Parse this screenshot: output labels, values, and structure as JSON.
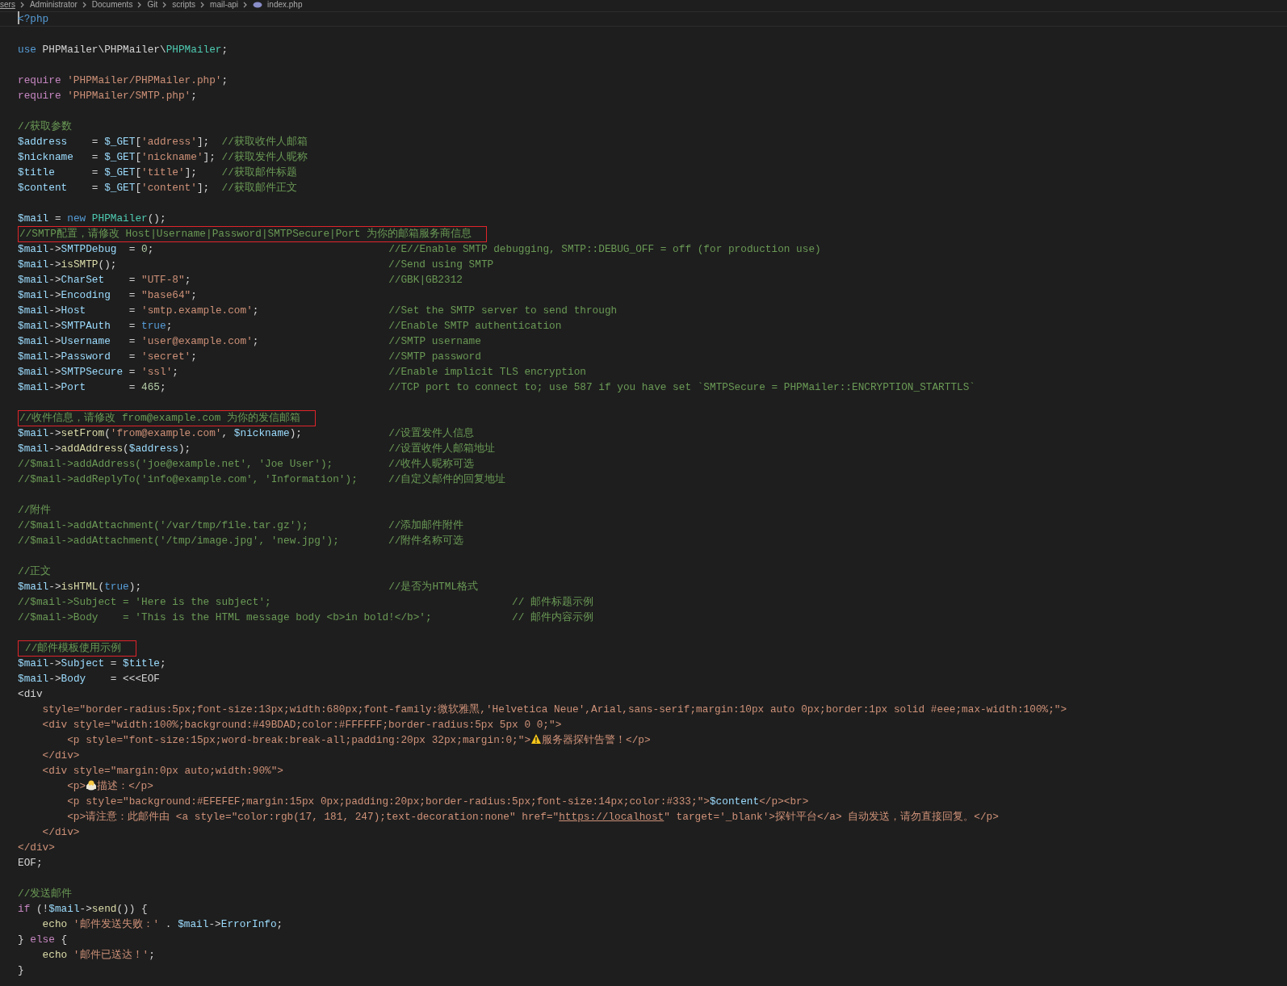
{
  "breadcrumb": [
    "sers",
    "Administrator",
    "Documents",
    "Git",
    "scripts",
    "mail-api",
    "index.php"
  ],
  "lines": [
    {
      "kind": "code",
      "current": true,
      "boxed": false,
      "tokens": [
        {
          "kind": "keyword",
          "text": "<?php"
        }
      ]
    },
    {
      "kind": "blank"
    },
    {
      "kind": "code",
      "current": false,
      "boxed": false,
      "tokens": [
        {
          "kind": "keyword",
          "text": "use"
        },
        {
          "kind": "plain",
          "text": " PHPMailer\\PHPMailer\\"
        },
        {
          "kind": "class",
          "text": "PHPMailer"
        },
        {
          "kind": "plain",
          "text": ";"
        }
      ]
    },
    {
      "kind": "blank"
    },
    {
      "kind": "code",
      "current": false,
      "boxed": false,
      "tokens": [
        {
          "kind": "control",
          "text": "require"
        },
        {
          "kind": "string",
          "text": " 'PHPMailer/PHPMailer.php'"
        },
        {
          "kind": "plain",
          "text": ";"
        }
      ]
    },
    {
      "kind": "code",
      "current": false,
      "boxed": false,
      "tokens": [
        {
          "kind": "control",
          "text": "require"
        },
        {
          "kind": "string",
          "text": " 'PHPMailer/SMTP.php'"
        },
        {
          "kind": "plain",
          "text": ";"
        }
      ]
    },
    {
      "kind": "blank"
    },
    {
      "kind": "code",
      "current": false,
      "boxed": false,
      "tokens": [
        {
          "kind": "comment",
          "text": "//获取参数"
        }
      ]
    },
    {
      "kind": "code",
      "current": false,
      "boxed": false,
      "tokens": [
        {
          "kind": "variable",
          "text": "$address"
        },
        {
          "kind": "plain",
          "text": "    = "
        },
        {
          "kind": "variable",
          "text": "$_GET"
        },
        {
          "kind": "plain",
          "text": "["
        },
        {
          "kind": "string",
          "text": "'address'"
        },
        {
          "kind": "plain",
          "text": "];  "
        },
        {
          "kind": "comment",
          "text": "//获取收件人邮箱"
        }
      ]
    },
    {
      "kind": "code",
      "current": false,
      "boxed": false,
      "tokens": [
        {
          "kind": "variable",
          "text": "$nickname"
        },
        {
          "kind": "plain",
          "text": "   = "
        },
        {
          "kind": "variable",
          "text": "$_GET"
        },
        {
          "kind": "plain",
          "text": "["
        },
        {
          "kind": "string",
          "text": "'nickname'"
        },
        {
          "kind": "plain",
          "text": "]; "
        },
        {
          "kind": "comment",
          "text": "//获取发件人昵称"
        }
      ]
    },
    {
      "kind": "code",
      "current": false,
      "boxed": false,
      "tokens": [
        {
          "kind": "variable",
          "text": "$title"
        },
        {
          "kind": "plain",
          "text": "      = "
        },
        {
          "kind": "variable",
          "text": "$_GET"
        },
        {
          "kind": "plain",
          "text": "["
        },
        {
          "kind": "string",
          "text": "'title'"
        },
        {
          "kind": "plain",
          "text": "];    "
        },
        {
          "kind": "comment",
          "text": "//获取邮件标题"
        }
      ]
    },
    {
      "kind": "code",
      "current": false,
      "boxed": false,
      "tokens": [
        {
          "kind": "variable",
          "text": "$content"
        },
        {
          "kind": "plain",
          "text": "    = "
        },
        {
          "kind": "variable",
          "text": "$_GET"
        },
        {
          "kind": "plain",
          "text": "["
        },
        {
          "kind": "string",
          "text": "'content'"
        },
        {
          "kind": "plain",
          "text": "];  "
        },
        {
          "kind": "comment",
          "text": "//获取邮件正文"
        }
      ]
    },
    {
      "kind": "blank"
    },
    {
      "kind": "code",
      "current": false,
      "boxed": false,
      "tokens": [
        {
          "kind": "variable",
          "text": "$mail"
        },
        {
          "kind": "plain",
          "text": " = "
        },
        {
          "kind": "keyword",
          "text": "new"
        },
        {
          "kind": "class",
          "text": " PHPMailer"
        },
        {
          "kind": "plain",
          "text": "();"
        }
      ]
    },
    {
      "kind": "code",
      "current": false,
      "boxed": true,
      "tokens": [
        {
          "kind": "comment",
          "text": "//SMTP配置，请修改 Host|Username|Password|SMTPSecure|Port 为你的邮箱服务商信息"
        }
      ]
    },
    {
      "kind": "code",
      "current": false,
      "boxed": false,
      "tokens": [
        {
          "kind": "variable",
          "text": "$mail"
        },
        {
          "kind": "plain",
          "text": "->"
        },
        {
          "kind": "variable",
          "text": "SMTPDebug"
        },
        {
          "kind": "plain",
          "text": "  = "
        },
        {
          "kind": "number",
          "text": "0"
        },
        {
          "kind": "plain",
          "text": ";                                      "
        },
        {
          "kind": "comment",
          "text": "//E//Enable SMTP debugging, SMTP::DEBUG_OFF = off (for production use)"
        }
      ]
    },
    {
      "kind": "code",
      "current": false,
      "boxed": false,
      "tokens": [
        {
          "kind": "variable",
          "text": "$mail"
        },
        {
          "kind": "plain",
          "text": "->"
        },
        {
          "kind": "function",
          "text": "isSMTP"
        },
        {
          "kind": "plain",
          "text": "();                                            "
        },
        {
          "kind": "comment",
          "text": "//Send using SMTP"
        }
      ]
    },
    {
      "kind": "code",
      "current": false,
      "boxed": false,
      "tokens": [
        {
          "kind": "variable",
          "text": "$mail"
        },
        {
          "kind": "plain",
          "text": "->"
        },
        {
          "kind": "variable",
          "text": "CharSet"
        },
        {
          "kind": "plain",
          "text": "    = "
        },
        {
          "kind": "string",
          "text": "\"UTF-8\""
        },
        {
          "kind": "plain",
          "text": ";                                "
        },
        {
          "kind": "comment",
          "text": "//GBK|GB2312"
        }
      ]
    },
    {
      "kind": "code",
      "current": false,
      "boxed": false,
      "tokens": [
        {
          "kind": "variable",
          "text": "$mail"
        },
        {
          "kind": "plain",
          "text": "->"
        },
        {
          "kind": "variable",
          "text": "Encoding"
        },
        {
          "kind": "plain",
          "text": "   = "
        },
        {
          "kind": "string",
          "text": "\"base64\""
        },
        {
          "kind": "plain",
          "text": ";"
        }
      ]
    },
    {
      "kind": "code",
      "current": false,
      "boxed": false,
      "tokens": [
        {
          "kind": "variable",
          "text": "$mail"
        },
        {
          "kind": "plain",
          "text": "->"
        },
        {
          "kind": "variable",
          "text": "Host"
        },
        {
          "kind": "plain",
          "text": "       = "
        },
        {
          "kind": "string",
          "text": "'smtp.example.com'"
        },
        {
          "kind": "plain",
          "text": ";                     "
        },
        {
          "kind": "comment",
          "text": "//Set the SMTP server to send through"
        }
      ]
    },
    {
      "kind": "code",
      "current": false,
      "boxed": false,
      "tokens": [
        {
          "kind": "variable",
          "text": "$mail"
        },
        {
          "kind": "plain",
          "text": "->"
        },
        {
          "kind": "variable",
          "text": "SMTPAuth"
        },
        {
          "kind": "plain",
          "text": "   = "
        },
        {
          "kind": "keyword",
          "text": "true"
        },
        {
          "kind": "plain",
          "text": ";                                   "
        },
        {
          "kind": "comment",
          "text": "//Enable SMTP authentication"
        }
      ]
    },
    {
      "kind": "code",
      "current": false,
      "boxed": false,
      "tokens": [
        {
          "kind": "variable",
          "text": "$mail"
        },
        {
          "kind": "plain",
          "text": "->"
        },
        {
          "kind": "variable",
          "text": "Username"
        },
        {
          "kind": "plain",
          "text": "   = "
        },
        {
          "kind": "string",
          "text": "'user@example.com'"
        },
        {
          "kind": "plain",
          "text": ";                     "
        },
        {
          "kind": "comment",
          "text": "//SMTP username"
        }
      ]
    },
    {
      "kind": "code",
      "current": false,
      "boxed": false,
      "tokens": [
        {
          "kind": "variable",
          "text": "$mail"
        },
        {
          "kind": "plain",
          "text": "->"
        },
        {
          "kind": "variable",
          "text": "Password"
        },
        {
          "kind": "plain",
          "text": "   = "
        },
        {
          "kind": "string",
          "text": "'secret'"
        },
        {
          "kind": "plain",
          "text": ";                               "
        },
        {
          "kind": "comment",
          "text": "//SMTP password"
        }
      ]
    },
    {
      "kind": "code",
      "current": false,
      "boxed": false,
      "tokens": [
        {
          "kind": "variable",
          "text": "$mail"
        },
        {
          "kind": "plain",
          "text": "->"
        },
        {
          "kind": "variable",
          "text": "SMTPSecure"
        },
        {
          "kind": "plain",
          "text": " = "
        },
        {
          "kind": "string",
          "text": "'ssl'"
        },
        {
          "kind": "plain",
          "text": ";                                  "
        },
        {
          "kind": "comment",
          "text": "//Enable implicit TLS encryption"
        }
      ]
    },
    {
      "kind": "code",
      "current": false,
      "boxed": false,
      "tokens": [
        {
          "kind": "variable",
          "text": "$mail"
        },
        {
          "kind": "plain",
          "text": "->"
        },
        {
          "kind": "variable",
          "text": "Port"
        },
        {
          "kind": "plain",
          "text": "       = "
        },
        {
          "kind": "number",
          "text": "465"
        },
        {
          "kind": "plain",
          "text": ";                                    "
        },
        {
          "kind": "comment",
          "text": "//TCP port to connect to; use 587 if you have set `SMTPSecure = PHPMailer::ENCRYPTION_STARTTLS`"
        }
      ]
    },
    {
      "kind": "blank"
    },
    {
      "kind": "code",
      "current": false,
      "boxed": true,
      "tokens": [
        {
          "kind": "comment",
          "text": "//收件信息，请修改 from@example.com 为你的发信邮箱"
        }
      ]
    },
    {
      "kind": "code",
      "current": false,
      "boxed": false,
      "tokens": [
        {
          "kind": "variable",
          "text": "$mail"
        },
        {
          "kind": "plain",
          "text": "->"
        },
        {
          "kind": "function",
          "text": "setFrom"
        },
        {
          "kind": "plain",
          "text": "("
        },
        {
          "kind": "string",
          "text": "'from@example.com'"
        },
        {
          "kind": "plain",
          "text": ", "
        },
        {
          "kind": "variable",
          "text": "$nickname"
        },
        {
          "kind": "plain",
          "text": ");              "
        },
        {
          "kind": "comment",
          "text": "//设置发件人信息"
        }
      ]
    },
    {
      "kind": "code",
      "current": false,
      "boxed": false,
      "tokens": [
        {
          "kind": "variable",
          "text": "$mail"
        },
        {
          "kind": "plain",
          "text": "->"
        },
        {
          "kind": "function",
          "text": "addAddress"
        },
        {
          "kind": "plain",
          "text": "("
        },
        {
          "kind": "variable",
          "text": "$address"
        },
        {
          "kind": "plain",
          "text": ");                                "
        },
        {
          "kind": "comment",
          "text": "//设置收件人邮箱地址"
        }
      ]
    },
    {
      "kind": "code",
      "current": false,
      "boxed": false,
      "tokens": [
        {
          "kind": "comment",
          "text": "//$mail->addAddress('joe@example.net', 'Joe User');         //收件人昵称可选"
        }
      ]
    },
    {
      "kind": "code",
      "current": false,
      "boxed": false,
      "tokens": [
        {
          "kind": "comment",
          "text": "//$mail->addReplyTo('info@example.com', 'Information');     //自定义邮件的回复地址"
        }
      ]
    },
    {
      "kind": "blank"
    },
    {
      "kind": "code",
      "current": false,
      "boxed": false,
      "tokens": [
        {
          "kind": "comment",
          "text": "//附件"
        }
      ]
    },
    {
      "kind": "code",
      "current": false,
      "boxed": false,
      "tokens": [
        {
          "kind": "comment",
          "text": "//$mail->addAttachment('/var/tmp/file.tar.gz');             //添加邮件附件"
        }
      ]
    },
    {
      "kind": "code",
      "current": false,
      "boxed": false,
      "tokens": [
        {
          "kind": "comment",
          "text": "//$mail->addAttachment('/tmp/image.jpg', 'new.jpg');        //附件名称可选"
        }
      ]
    },
    {
      "kind": "blank"
    },
    {
      "kind": "code",
      "current": false,
      "boxed": false,
      "tokens": [
        {
          "kind": "comment",
          "text": "//正文"
        }
      ]
    },
    {
      "kind": "code",
      "current": false,
      "boxed": false,
      "tokens": [
        {
          "kind": "variable",
          "text": "$mail"
        },
        {
          "kind": "plain",
          "text": "->"
        },
        {
          "kind": "function",
          "text": "isHTML"
        },
        {
          "kind": "plain",
          "text": "("
        },
        {
          "kind": "keyword",
          "text": "true"
        },
        {
          "kind": "plain",
          "text": ");                                        "
        },
        {
          "kind": "comment",
          "text": "//是否为HTML格式"
        }
      ]
    },
    {
      "kind": "code",
      "current": false,
      "boxed": false,
      "tokens": [
        {
          "kind": "comment",
          "text": "//$mail->Subject = 'Here is the subject';                                       // 邮件标题示例"
        }
      ]
    },
    {
      "kind": "code",
      "current": false,
      "boxed": false,
      "tokens": [
        {
          "kind": "comment",
          "text": "//$mail->Body    = 'This is the HTML message body <b>in bold!</b>';             // 邮件内容示例"
        }
      ]
    },
    {
      "kind": "blank"
    },
    {
      "kind": "code",
      "current": false,
      "boxed": true,
      "tokens": [
        {
          "kind": "comment",
          "text": "//邮件模板使用示例"
        }
      ]
    },
    {
      "kind": "code",
      "current": false,
      "boxed": false,
      "tokens": [
        {
          "kind": "variable",
          "text": "$mail"
        },
        {
          "kind": "plain",
          "text": "->"
        },
        {
          "kind": "variable",
          "text": "Subject"
        },
        {
          "kind": "plain",
          "text": " = "
        },
        {
          "kind": "variable",
          "text": "$title"
        },
        {
          "kind": "plain",
          "text": ";"
        }
      ]
    },
    {
      "kind": "code",
      "current": false,
      "boxed": false,
      "tokens": [
        {
          "kind": "variable",
          "text": "$mail"
        },
        {
          "kind": "plain",
          "text": "->"
        },
        {
          "kind": "variable",
          "text": "Body"
        },
        {
          "kind": "plain",
          "text": "    = <<<EOF"
        }
      ]
    },
    {
      "kind": "code",
      "current": false,
      "boxed": false,
      "tokens": [
        {
          "kind": "plain",
          "text": "<div"
        }
      ]
    },
    {
      "kind": "code",
      "current": false,
      "boxed": false,
      "tokens": [
        {
          "kind": "string",
          "text": "    style=\"border-radius:5px;font-size:13px;width:680px;font-family:微软雅黑,'Helvetica Neue',Arial,sans-serif;margin:10px auto 0px;border:1px solid #eee;max-width:100%;\">"
        }
      ]
    },
    {
      "kind": "code",
      "current": false,
      "boxed": false,
      "tokens": [
        {
          "kind": "string",
          "text": "    <div style=\"width:100%;background:#49BDAD;color:#FFFFFF;border-radius:5px 5px 0 0;\">"
        }
      ]
    },
    {
      "kind": "code",
      "current": false,
      "boxed": false,
      "tokens": [
        {
          "kind": "string",
          "text": "        <p style=\"font-size:15px;word-break:break-all;padding:20px 32px;margin:0;\">"
        },
        {
          "kind": "warning_icon"
        },
        {
          "kind": "string",
          "text": "服务器探针告警！</p>"
        }
      ]
    },
    {
      "kind": "code",
      "current": false,
      "boxed": false,
      "tokens": [
        {
          "kind": "string",
          "text": "    </div>"
        }
      ]
    },
    {
      "kind": "code",
      "current": false,
      "boxed": false,
      "tokens": [
        {
          "kind": "string",
          "text": "    <div style=\"margin:0px auto;width:90%\">"
        }
      ]
    },
    {
      "kind": "code",
      "current": false,
      "boxed": false,
      "tokens": [
        {
          "kind": "string",
          "text": "        <p>"
        },
        {
          "kind": "chick_icon"
        },
        {
          "kind": "string",
          "text": "描述：</p>"
        }
      ]
    },
    {
      "kind": "code",
      "current": false,
      "boxed": false,
      "tokens": [
        {
          "kind": "string",
          "text": "        <p style=\"background:#EFEFEF;margin:15px 0px;padding:20px;border-radius:5px;font-size:14px;color:#333;\">"
        },
        {
          "kind": "variable",
          "text": "$content"
        },
        {
          "kind": "string",
          "text": "</p><br>"
        }
      ]
    },
    {
      "kind": "code",
      "current": false,
      "boxed": false,
      "tokens": [
        {
          "kind": "string",
          "text": "        <p>请注意：此邮件由 <a style=\"color:rgb(17, 181, 247);text-decoration:none\" href=\""
        },
        {
          "kind": "link",
          "text": "https://localhost"
        },
        {
          "kind": "string",
          "text": "\" target='_blank'>探针平台</a> 自动发送，请勿直接回复。</p>"
        }
      ]
    },
    {
      "kind": "code",
      "current": false,
      "boxed": false,
      "tokens": [
        {
          "kind": "string",
          "text": "    </div>"
        }
      ]
    },
    {
      "kind": "code",
      "current": false,
      "boxed": false,
      "tokens": [
        {
          "kind": "string",
          "text": "</div>"
        }
      ]
    },
    {
      "kind": "code",
      "current": false,
      "boxed": false,
      "tokens": [
        {
          "kind": "plain",
          "text": "EOF;"
        }
      ]
    },
    {
      "kind": "blank"
    },
    {
      "kind": "code",
      "current": false,
      "boxed": false,
      "tokens": [
        {
          "kind": "comment",
          "text": "//发送邮件"
        }
      ]
    },
    {
      "kind": "code",
      "current": false,
      "boxed": false,
      "tokens": [
        {
          "kind": "control",
          "text": "if"
        },
        {
          "kind": "plain",
          "text": " (!"
        },
        {
          "kind": "variable",
          "text": "$mail"
        },
        {
          "kind": "plain",
          "text": "->"
        },
        {
          "kind": "function",
          "text": "send"
        },
        {
          "kind": "plain",
          "text": "()) {"
        }
      ]
    },
    {
      "kind": "code",
      "current": false,
      "boxed": false,
      "tokens": [
        {
          "kind": "function",
          "text": "    echo"
        },
        {
          "kind": "string",
          "text": " '邮件发送失败：'"
        },
        {
          "kind": "plain",
          "text": " . "
        },
        {
          "kind": "variable",
          "text": "$mail"
        },
        {
          "kind": "plain",
          "text": "->"
        },
        {
          "kind": "variable",
          "text": "ErrorInfo"
        },
        {
          "kind": "plain",
          "text": ";"
        }
      ]
    },
    {
      "kind": "code",
      "current": false,
      "boxed": false,
      "tokens": [
        {
          "kind": "plain",
          "text": "} "
        },
        {
          "kind": "control",
          "text": "else"
        },
        {
          "kind": "plain",
          "text": " {"
        }
      ]
    },
    {
      "kind": "code",
      "current": false,
      "boxed": false,
      "tokens": [
        {
          "kind": "function",
          "text": "    echo"
        },
        {
          "kind": "string",
          "text": " '邮件已送达！'"
        },
        {
          "kind": "plain",
          "text": ";"
        }
      ]
    },
    {
      "kind": "code",
      "current": false,
      "boxed": false,
      "tokens": [
        {
          "kind": "plain",
          "text": "}"
        }
      ]
    }
  ]
}
